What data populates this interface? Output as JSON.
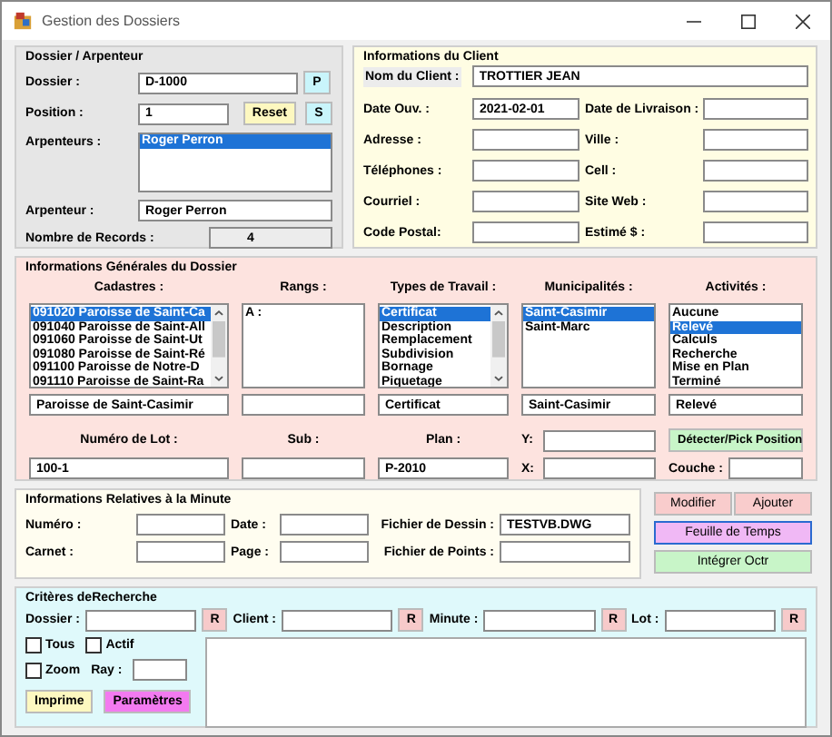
{
  "window": {
    "title": "Gestion des Dossiers"
  },
  "dossier_group": {
    "title": "Dossier / Arpenteur",
    "dossier": {
      "label": "Dossier :",
      "value": "D-1000"
    },
    "p_button": "P",
    "position": {
      "label": "Position :",
      "value": "1"
    },
    "reset_button": "Reset",
    "s_button": "S",
    "arpenteurs": {
      "label": "Arpenteurs :",
      "items": [
        {
          "text": "Roger Perron",
          "selected": true
        }
      ]
    },
    "arpenteur": {
      "label": "Arpenteur :",
      "value": "Roger Perron"
    },
    "records": {
      "label": "Nombre de Records :",
      "value": "4"
    }
  },
  "client_group": {
    "title": "Informations du Client",
    "name": {
      "label": "Nom du Client :",
      "value": "TROTTIER JEAN"
    },
    "fields": [
      {
        "label": "Date Ouv. :",
        "value": "2021-02-01"
      },
      {
        "label": "Date de Livraison :"
      },
      {
        "label": "Adresse :"
      },
      {
        "label": "Ville :"
      },
      {
        "label": "Téléphones :"
      },
      {
        "label": "Cell :"
      },
      {
        "label": "Courriel :"
      },
      {
        "label": "Site Web :"
      },
      {
        "label": "Code Postal:"
      },
      {
        "label": "Estimé $ :"
      }
    ]
  },
  "general_group": {
    "title": "Informations Générales du Dossier",
    "lists": [
      {
        "label": "Cadastres :",
        "scrollbar": true,
        "value": "Paroisse de Saint-Casimir",
        "items": [
          {
            "text": "091020 Paroisse de Saint-Ca",
            "selected": true
          },
          {
            "text": "091040 Paroisse de Saint-All",
            "selected": false
          },
          {
            "text": "091060 Paroisse de Saint-Ut",
            "selected": false
          },
          {
            "text": "091080 Paroisse de Saint-Ré",
            "selected": false
          },
          {
            "text": "091100 Paroisse de Notre-D",
            "selected": false
          },
          {
            "text": "091110 Paroisse de Saint-Ra",
            "selected": false
          }
        ]
      },
      {
        "label": "Rangs :",
        "scrollbar": false,
        "items": [
          {
            "text": "A :",
            "selected": false
          }
        ]
      },
      {
        "label": "Types de Travail :",
        "scrollbar": true,
        "value": "Certificat",
        "items": [
          {
            "text": "Certificat",
            "selected": true
          },
          {
            "text": "Description",
            "selected": false
          },
          {
            "text": "Remplacement",
            "selected": false
          },
          {
            "text": "Subdivision",
            "selected": false
          },
          {
            "text": "Bornage",
            "selected": false
          },
          {
            "text": "Piquetage",
            "selected": false
          }
        ]
      },
      {
        "label": "Municipalités :",
        "scrollbar": false,
        "value": "Saint-Casimir",
        "items": [
          {
            "text": "Saint-Casimir",
            "selected": true
          },
          {
            "text": "Saint-Marc",
            "selected": false
          }
        ]
      },
      {
        "label": "Activités :",
        "scrollbar": false,
        "value": "Relevé",
        "items": [
          {
            "text": "Aucune",
            "selected": false
          },
          {
            "text": "Relevé",
            "selected": true
          },
          {
            "text": "Calculs",
            "selected": false
          },
          {
            "text": "Recherche",
            "selected": false
          },
          {
            "text": "Mise en Plan",
            "selected": false
          },
          {
            "text": "Terminé",
            "selected": false
          }
        ]
      }
    ],
    "lot_fields": [
      {
        "label": "Numéro de Lot :",
        "value": "100-1"
      },
      {
        "label": "Sub :"
      },
      {
        "label": "Plan :",
        "value": "P-2010"
      }
    ],
    "coords": [
      {
        "label": "Y:"
      },
      {
        "label": "X:"
      }
    ],
    "detect_button": "Détecter/Pick Position",
    "couche": {
      "label": "Couche :"
    }
  },
  "minute_group": {
    "title": "Informations Relatives à la Minute",
    "rows": [
      [
        {
          "label": "Numéro :"
        },
        {
          "label": "Date :"
        },
        {
          "label": "Fichier de Dessin :",
          "value": "TESTVB.DWG"
        }
      ],
      [
        {
          "label": "Carnet :"
        },
        {
          "label": "Page :"
        },
        {
          "label": "Fichier de Points :"
        }
      ]
    ]
  },
  "action_buttons": {
    "modifier": "Modifier",
    "ajouter": "Ajouter",
    "feuille": "Feuille de Temps",
    "integrer": "Intégrer Octr"
  },
  "search_group": {
    "title": "Critères deRecherche",
    "criteria": [
      {
        "label": "Dossier :",
        "button": "R"
      },
      {
        "label": "Client :",
        "button": "R"
      },
      {
        "label": "Minute :",
        "button": "R"
      },
      {
        "label": "Lot :",
        "button": "R"
      }
    ],
    "checkboxes": [
      {
        "label": "Tous",
        "checked": false
      },
      {
        "label": "Actif",
        "checked": false
      },
      {
        "label": "Zoom",
        "checked": false
      }
    ],
    "ray": {
      "label": "Ray :"
    },
    "print_button": "Imprime",
    "params_button": "Paramètres"
  }
}
